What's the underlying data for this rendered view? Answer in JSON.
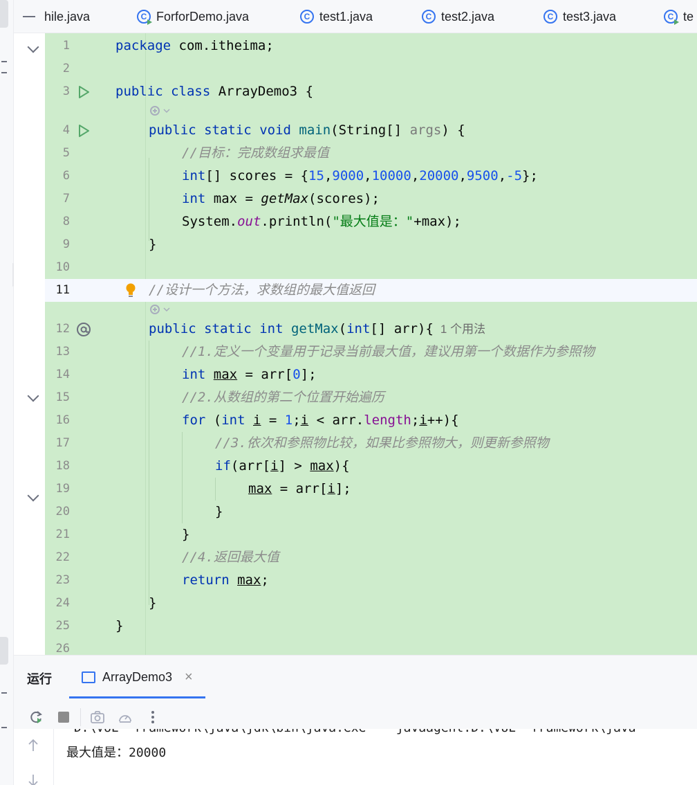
{
  "tabs": [
    {
      "label": "hile.java",
      "icon": "java-file-icon"
    },
    {
      "label": "ForforDemo.java",
      "icon": "run-class-icon"
    },
    {
      "label": "test1.java",
      "icon": "class-icon"
    },
    {
      "label": "test2.java",
      "icon": "class-icon"
    },
    {
      "label": "test3.java",
      "icon": "class-icon"
    },
    {
      "label": "te",
      "icon": "run-class-icon"
    }
  ],
  "editor": {
    "active_line": 11,
    "highlight_color": "#ceeccc",
    "line_numbers": [
      "1",
      "2",
      "3",
      "4",
      "5",
      "6",
      "7",
      "8",
      "9",
      "10",
      "11",
      "12",
      "13",
      "14",
      "15",
      "16",
      "17",
      "18",
      "19",
      "20",
      "21",
      "22",
      "23",
      "24",
      "25",
      "26"
    ],
    "code": {
      "l1": {
        "kw": "package",
        "rest": " com.itheima;"
      },
      "l3": {
        "kw1": "public",
        "kw2": "class",
        "rest": " ArrayDemo3 {"
      },
      "l4": {
        "kw1": "public",
        "kw2": "static",
        "kw3": "void",
        "method": "main",
        "p1": "(String[] ",
        "param": "args",
        "p2": ") {"
      },
      "l5": {
        "comment": "//目标：完成数组求最值"
      },
      "l6": {
        "type": "int",
        "p1": "[] scores = {",
        "n1": "15",
        "n2": "9000",
        "n3": "10000",
        "n4": "20000",
        "n5": "9500",
        "n6": "-5",
        "p2": "};",
        "comma": ","
      },
      "l7": {
        "type": "int",
        "p1": " max = ",
        "call": "getMax",
        "p2": "(scores);"
      },
      "l8": {
        "p1": "System.",
        "field": "out",
        "p2": ".println(",
        "str": "\"最大值是：\"",
        "p3": "+max);"
      },
      "l9": {
        "text": "}"
      },
      "l11": {
        "comment": "//设计一个方法，求数组的最大值返回"
      },
      "l12": {
        "kw1": "public",
        "kw2": "static",
        "kw3": "int",
        "method": "getMax",
        "p1": "(",
        "type": "int",
        "p2": "[] arr){",
        "usage": "1 个用法"
      },
      "l13": {
        "comment": "//1.定义一个变量用于记录当前最大值，建议用第一个数据作为参照物"
      },
      "l14": {
        "type": "int",
        "var": "max",
        "p1": " = arr[",
        "num": "0",
        "p2": "];"
      },
      "l15": {
        "comment": "//2.从数组的第二个位置开始遍历"
      },
      "l16": {
        "kw": "for",
        "p1": " (",
        "type": "int",
        "var": "i",
        "p2": " = ",
        "num": "1",
        "p3": ";",
        "var2": "i",
        "p4": " < arr.",
        "field": "length",
        "p5": ";",
        "var3": "i",
        "p6": "++){"
      },
      "l17": {
        "comment": "//3.依次和参照物比较，如果比参照物大，则更新参照物"
      },
      "l18": {
        "kw": "if",
        "p1": "(arr[",
        "var": "i",
        "p2": "] > ",
        "var2": "max",
        "p3": "){"
      },
      "l19": {
        "var": "max",
        "p1": " = arr[",
        "var2": "i",
        "p2": "];"
      },
      "l20": {
        "text": "}"
      },
      "l21": {
        "text": "}"
      },
      "l22": {
        "comment": "//4.返回最大值"
      },
      "l23": {
        "kw": "return",
        "var": "max",
        "p1": ";"
      },
      "l24": {
        "text": "}"
      },
      "l25": {
        "text": "}"
      }
    }
  },
  "run_panel": {
    "title": "运行",
    "tab_label": "ArrayDemo3",
    "close_symbol": "×",
    "console_lines": [
      "\"D:\\VUE  framework\\java\\jdk\\bin\\java.exe\"  -javaagent:D:\\VUE  framework\\java",
      "最大值是：20000"
    ]
  }
}
